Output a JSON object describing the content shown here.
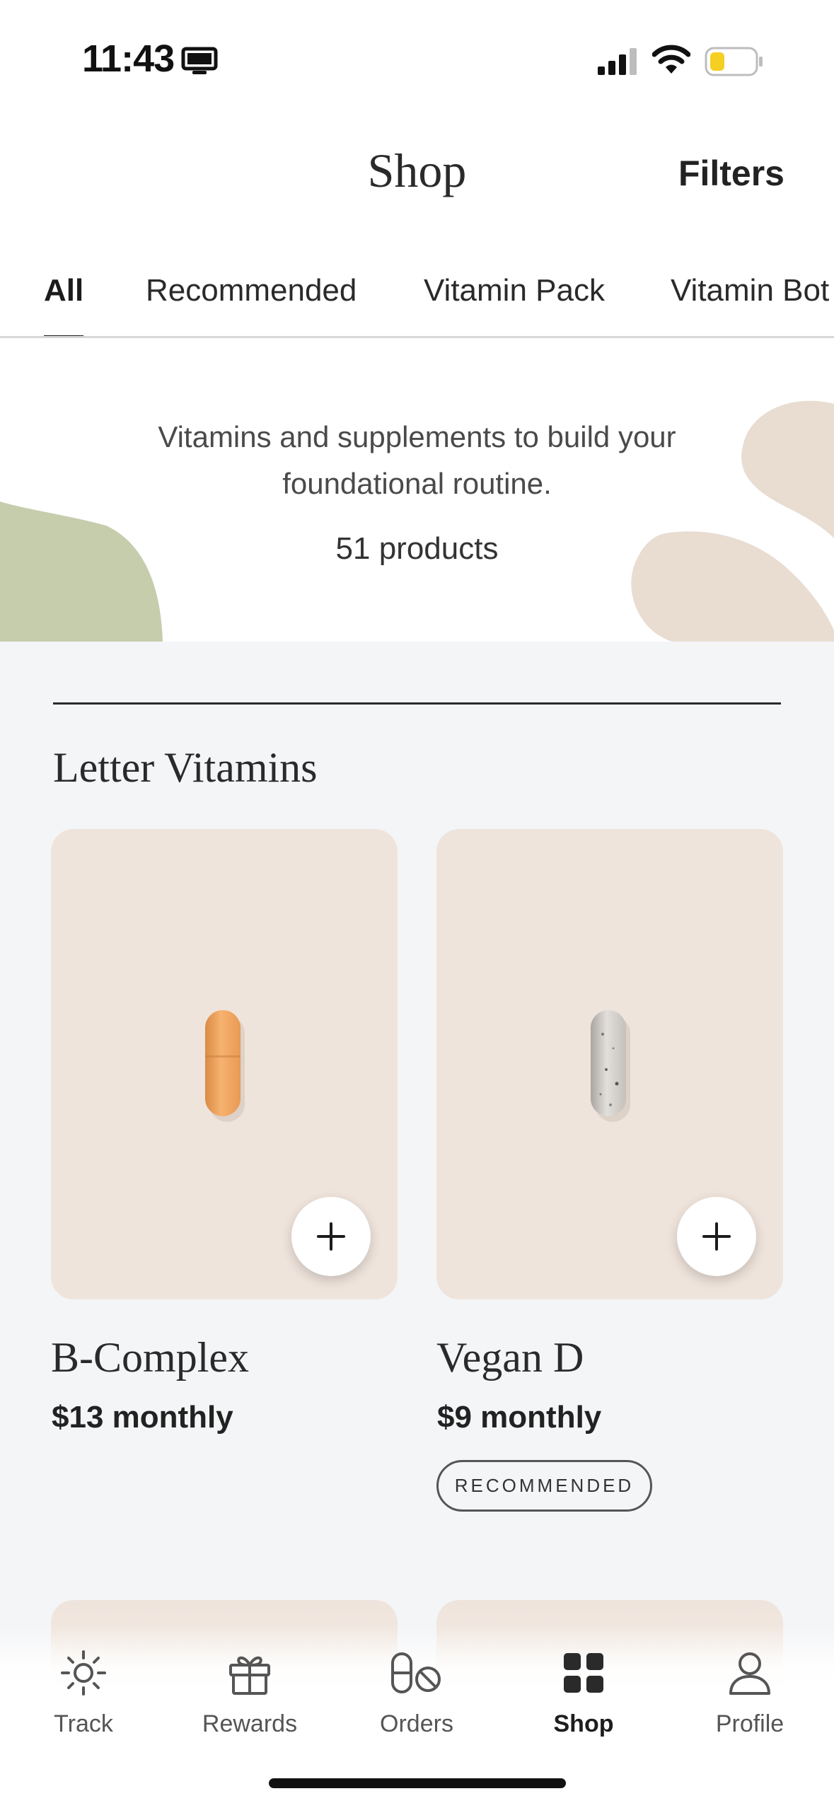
{
  "status_bar": {
    "time": "11:43",
    "icons": [
      "screen-mirroring-icon",
      "cellular-signal-icon",
      "wifi-icon",
      "battery-low-power-icon"
    ]
  },
  "header": {
    "title": "Shop",
    "filters_label": "Filters"
  },
  "tabs": [
    {
      "label": "All",
      "active": true
    },
    {
      "label": "Recommended",
      "active": false
    },
    {
      "label": "Vitamin Pack",
      "active": false
    },
    {
      "label": "Vitamin Bot",
      "active": false
    }
  ],
  "hero": {
    "description": "Vitamins and supplements to build your foundational routine.",
    "product_count": "51 products"
  },
  "section": {
    "title": "Letter Vitamins"
  },
  "products": [
    {
      "name": "B-Complex",
      "price": "$13 monthly",
      "badge": "",
      "pill_color": "#f2a864",
      "icon": "orange-capsule-icon"
    },
    {
      "name": "Vegan D",
      "price": "$9 monthly",
      "badge": "RECOMMENDED",
      "pill_color": "#d9d6d3",
      "icon": "speckled-capsule-icon"
    }
  ],
  "bottom_nav": [
    {
      "label": "Track",
      "icon": "sun-icon",
      "active": false
    },
    {
      "label": "Rewards",
      "icon": "gift-icon",
      "active": false
    },
    {
      "label": "Orders",
      "icon": "pill-cancel-icon",
      "active": false
    },
    {
      "label": "Shop",
      "icon": "grid-icon",
      "active": true
    },
    {
      "label": "Profile",
      "icon": "person-icon",
      "active": false
    }
  ],
  "colors": {
    "card_background": "#efe4dc",
    "main_background": "#f4f5f7",
    "hero_green_shape": "#c5cdad",
    "hero_beige_shape": "#e9dcd1",
    "text_primary": "#2a2a2a"
  }
}
